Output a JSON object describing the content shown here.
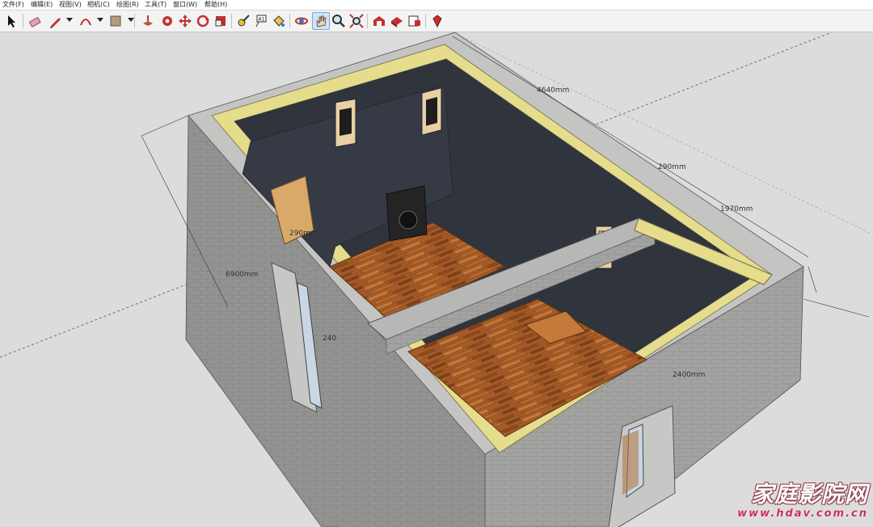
{
  "menu": {
    "items": [
      "文件(F)",
      "编辑(E)",
      "视图(V)",
      "相机(C)",
      "绘图(R)",
      "工具(T)",
      "窗口(W)",
      "帮助(H)"
    ]
  },
  "toolbar": {
    "tools": [
      {
        "name": "select-tool",
        "icon": "arrow-cursor-icon"
      },
      {
        "name": "eraser-tool",
        "icon": "eraser-icon"
      },
      {
        "name": "pencil-tool",
        "icon": "pencil-icon"
      },
      {
        "name": "arc-tool",
        "icon": "arc-icon"
      },
      {
        "name": "shape-tool",
        "icon": "rectangle-icon"
      },
      {
        "name": "push-pull-tool",
        "icon": "push-pull-icon"
      },
      {
        "name": "follow-me-tool",
        "icon": "follow-me-icon"
      },
      {
        "name": "move-tool",
        "icon": "move-arrows-icon"
      },
      {
        "name": "rotate-tool",
        "icon": "rotate-icon"
      },
      {
        "name": "scale-tool",
        "icon": "scale-icon"
      },
      {
        "name": "tape-measure-tool",
        "icon": "tape-measure-icon"
      },
      {
        "name": "text-tool",
        "icon": "text-label-icon"
      },
      {
        "name": "paint-bucket-tool",
        "icon": "paint-bucket-icon"
      },
      {
        "name": "orbit-tool",
        "icon": "orbit-icon"
      },
      {
        "name": "pan-tool",
        "icon": "hand-icon"
      },
      {
        "name": "zoom-tool",
        "icon": "magnifier-icon"
      },
      {
        "name": "zoom-extents-tool",
        "icon": "zoom-extents-icon"
      },
      {
        "name": "warehouse-tool",
        "icon": "warehouse-icon"
      },
      {
        "name": "share-model-tool",
        "icon": "share-model-icon"
      },
      {
        "name": "send-layout-tool",
        "icon": "send-to-layout-icon"
      },
      {
        "name": "ruby-tool",
        "icon": "ruby-icon"
      }
    ],
    "active_tool": "pan-tool"
  },
  "dimensions": {
    "top_length": "4640mm",
    "partition_thickness": "290mm",
    "rear_room_length": "1970mm",
    "left_width": "6900mm",
    "inner_partition": "290mm",
    "height_label": "240",
    "front_length": "2400mm"
  },
  "watermark": {
    "title": "家庭影院网",
    "url": "www.hdav.com.cn"
  },
  "colors": {
    "wall_block": "#9c9c9a",
    "wall_top": "#c8c8c6",
    "wall_cap": "#e6db8a",
    "interior_wall": "#353a44",
    "floor_wood": "#a45a26",
    "background": "#dcdcdc",
    "accent_watermark": "#c82f5a"
  }
}
